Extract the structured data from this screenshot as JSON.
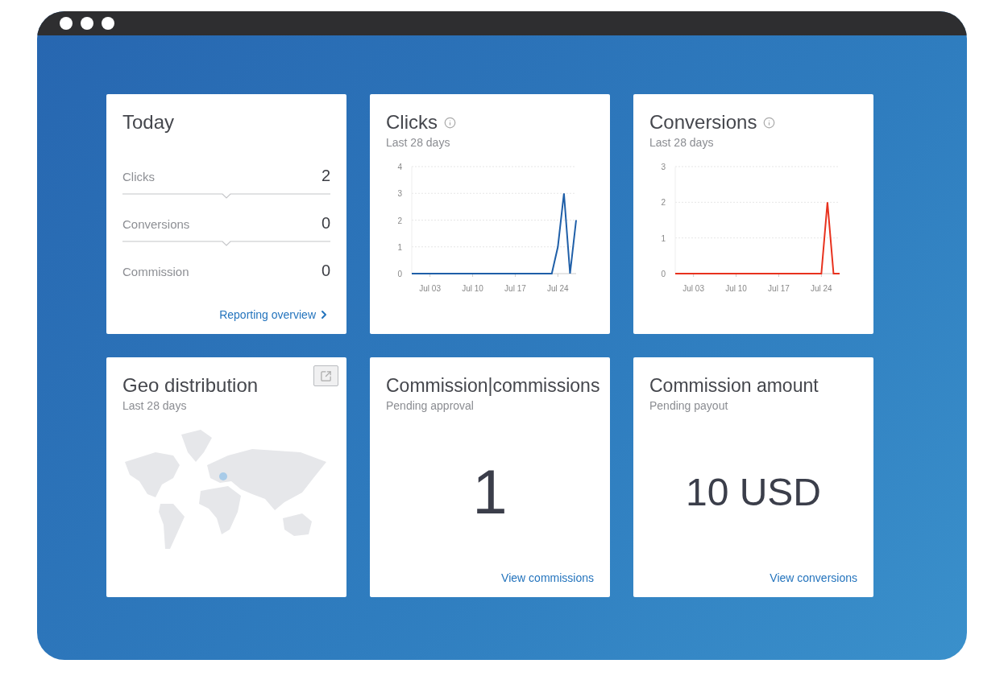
{
  "today": {
    "title": "Today",
    "rows": [
      {
        "label": "Clicks",
        "value": "2"
      },
      {
        "label": "Conversions",
        "value": "0"
      },
      {
        "label": "Commission",
        "value": "0"
      }
    ],
    "link": "Reporting overview"
  },
  "charts": [
    {
      "title": "Clicks",
      "subtitle": "Last 28 days",
      "chart_data": {
        "type": "line",
        "categories": [
          null,
          null,
          null,
          "Jul 03",
          null,
          null,
          null,
          null,
          null,
          null,
          "Jul 10",
          null,
          null,
          null,
          null,
          null,
          null,
          "Jul 17",
          null,
          null,
          null,
          null,
          null,
          null,
          "Jul 24",
          null,
          null,
          null
        ],
        "ylim": [
          0,
          4
        ],
        "grid": true,
        "yticks": [
          0,
          1,
          2,
          3,
          4
        ],
        "series": [
          {
            "color": "#1f5fa8",
            "values": [
              0,
              0,
              0,
              0,
              0,
              0,
              0,
              0,
              0,
              0,
              0,
              0,
              0,
              0,
              0,
              0,
              0,
              0,
              0,
              0,
              0,
              0,
              0,
              0,
              1,
              3,
              0,
              2
            ]
          }
        ]
      }
    },
    {
      "title": "Conversions",
      "subtitle": "Last 28 days",
      "chart_data": {
        "type": "line",
        "categories": [
          null,
          null,
          null,
          "Jul 03",
          null,
          null,
          null,
          null,
          null,
          null,
          "Jul 10",
          null,
          null,
          null,
          null,
          null,
          null,
          "Jul 17",
          null,
          null,
          null,
          null,
          null,
          null,
          "Jul 24",
          null,
          null,
          null
        ],
        "ylim": [
          0,
          3
        ],
        "grid": true,
        "yticks": [
          0,
          1,
          2,
          3
        ],
        "series": [
          {
            "color": "#e8321e",
            "values": [
              0,
              0,
              0,
              0,
              0,
              0,
              0,
              0,
              0,
              0,
              0,
              0,
              0,
              0,
              0,
              0,
              0,
              0,
              0,
              0,
              0,
              0,
              0,
              0,
              0,
              2,
              0,
              0
            ]
          }
        ]
      }
    }
  ],
  "geo": {
    "title": "Geo distribution",
    "subtitle": "Last 28 days"
  },
  "stats": [
    {
      "title": "Commission|commissions",
      "subtitle": "Pending approval",
      "value": "1",
      "link": "View commissions"
    },
    {
      "title": "Commission amount",
      "subtitle": "Pending payout",
      "value": "10 USD",
      "link": "View conversions"
    }
  ]
}
